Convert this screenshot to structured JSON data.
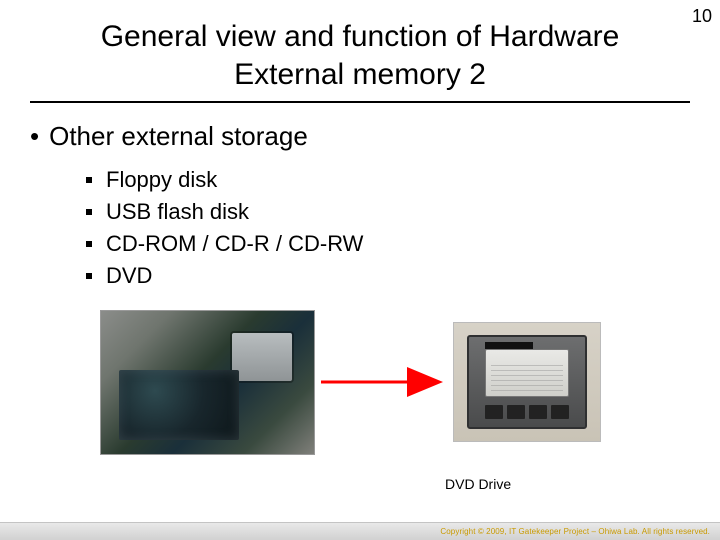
{
  "page_number": "10",
  "title_line1": "General view and function of Hardware",
  "title_line2": "External memory 2",
  "heading": "Other external storage",
  "bullets": {
    "b0": "Floppy disk",
    "b1": "USB flash disk",
    "b2": "CD-ROM / CD-R / CD-RW",
    "b3": "DVD"
  },
  "caption": "DVD Drive",
  "footer": "Copyright © 2009, IT Gatekeeper Project – Ohiwa Lab. All rights reserved.",
  "colors": {
    "arrow": "#ff0000"
  }
}
